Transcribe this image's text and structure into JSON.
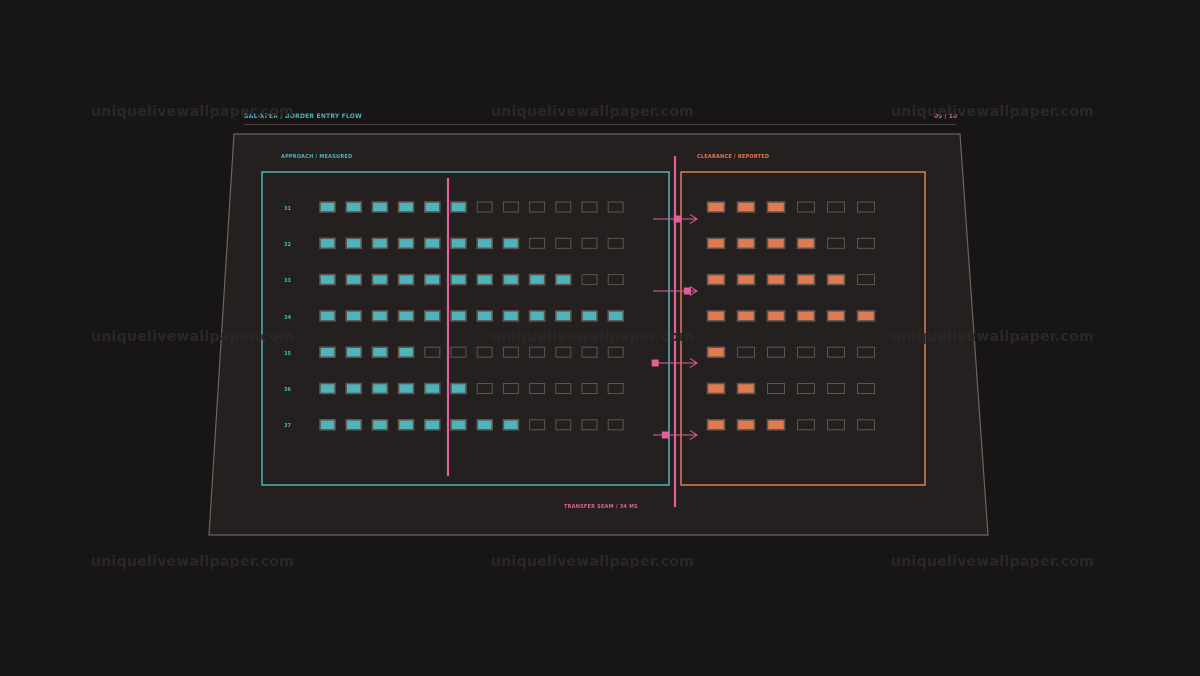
{
  "header": {
    "left": "BAL-XFER / BORDER ENTRY FLOW",
    "right": "09 / 10"
  },
  "approach": {
    "label": "APPROACH / MEASURED",
    "color": "#4fb3bb",
    "slots": 12,
    "cursor_after": 5,
    "rows": [
      {
        "label": "31",
        "filled": 6
      },
      {
        "label": "32",
        "filled": 8
      },
      {
        "label": "33",
        "filled": 10
      },
      {
        "label": "34",
        "filled": 12
      },
      {
        "label": "35",
        "filled": 4
      },
      {
        "label": "36",
        "filled": 6
      },
      {
        "label": "37",
        "filled": 8
      }
    ]
  },
  "clearance": {
    "label": "CLEARANCE / REPORTED",
    "color": "#e07a52",
    "slots": 6,
    "rows": [
      {
        "filled": 3
      },
      {
        "filled": 4
      },
      {
        "filled": 5
      },
      {
        "filled": 6
      },
      {
        "filled": 1
      },
      {
        "filled": 2
      },
      {
        "filled": 3
      }
    ]
  },
  "seam": {
    "label": "TRANSFER SEAM / 34 MS",
    "color": "#e25f9a",
    "transfers": [
      {
        "row": 0,
        "marker_offset": 0.55
      },
      {
        "row": 2,
        "marker_offset": 0.78
      },
      {
        "row": 4,
        "marker_offset": 0.05
      },
      {
        "row": 6,
        "marker_offset": 0.28
      }
    ]
  },
  "watermark": "uniquelivewallpaper.com",
  "colors": {
    "background": "#171515",
    "panel": "#242020",
    "panel_border": "#6e6558",
    "empty_slot": "#5e564d",
    "teal": "#4fb3bb",
    "orange": "#e07a52",
    "pink": "#e25f9a"
  }
}
